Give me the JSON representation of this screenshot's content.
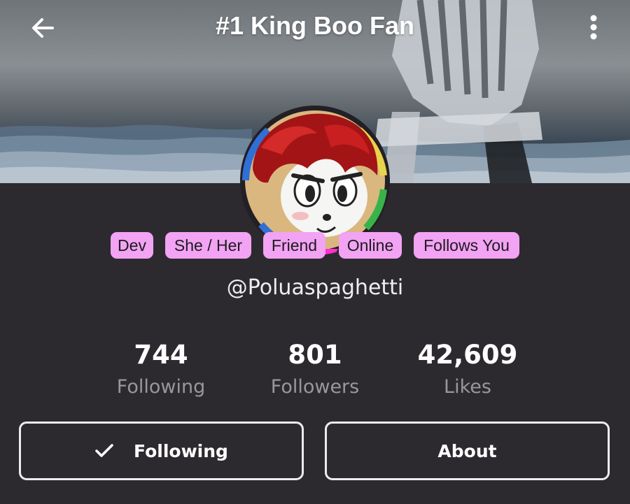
{
  "header": {
    "title": "#1 King Boo Fan",
    "back_icon": "arrow-left-icon",
    "menu_icon": "more-vertical-icon"
  },
  "profile": {
    "username": "@Poluaspaghetti",
    "tags": [
      "Dev",
      "She / Her",
      "Friend",
      "Online",
      "Follows You"
    ]
  },
  "stats": [
    {
      "value": "744",
      "label": "Following"
    },
    {
      "value": "801",
      "label": "Followers"
    },
    {
      "value": "42,609",
      "label": "Likes"
    }
  ],
  "actions": {
    "following_label": "Following",
    "following_icon": "check-icon",
    "about_label": "About"
  },
  "colors": {
    "background": "#2d2a2f",
    "tag_bg": "#f2a3f3",
    "tag_text": "#1c1a1e",
    "muted_text": "#9a979c",
    "button_border": "#ececec"
  }
}
